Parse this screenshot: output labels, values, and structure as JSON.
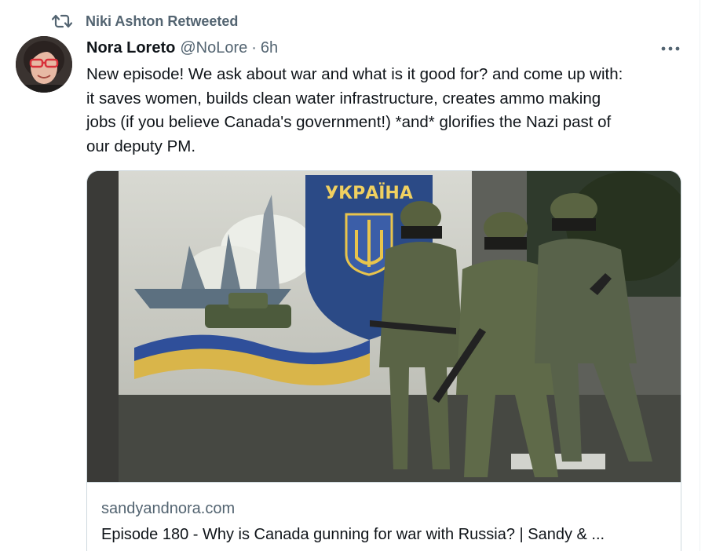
{
  "retweet": {
    "icon": "retweet-icon",
    "label": "Niki Ashton Retweeted"
  },
  "author": {
    "name": "Nora Loreto",
    "handle": "@NoLore",
    "separator": "·",
    "time": "6h",
    "avatar_icon": "avatar-photo"
  },
  "tweet": {
    "text": "New episode! We ask about war and what is it good for? and come up with:\nit saves women, builds clean water infrastructure, creates ammo making\njobs (if you believe Canada's government!) *and* glorifies the Nazi past of\nour deputy PM."
  },
  "more_menu": {
    "icon": "more-horizontal-icon"
  },
  "card": {
    "image_icon": "soldiers-mural-photo",
    "mural_text": "УКРАЇНА",
    "domain": "sandyandnora.com",
    "title": "Episode 180 - Why is Canada gunning for war with Russia? | Sandy & ..."
  },
  "colors": {
    "text_primary": "#0f1419",
    "text_secondary": "#536471",
    "border": "#cfd9de"
  }
}
